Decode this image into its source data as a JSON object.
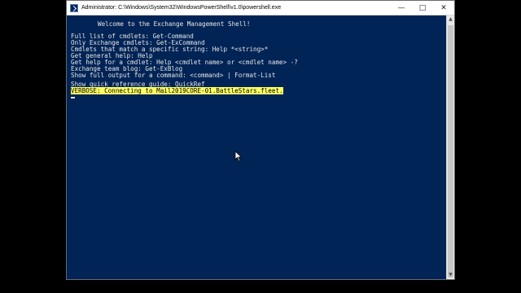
{
  "window": {
    "title": "Administrator: C:\\Windows\\System32\\WindowsPowerShell\\v1.0\\powershell.exe",
    "controls": [
      "—",
      "□",
      "✕"
    ]
  },
  "console": {
    "welcome": "Welcome to the Exchange Management Shell!",
    "lines": [
      "Full list of cmdlets: Get-Command",
      "Only Exchange cmdlets: Get-ExCommand",
      "Cmdlets that match a specific string: Help *<string>*",
      "Get general help: Help",
      "Get help for a cmdlet: Help <cmdlet name> or <cmdlet name> -?",
      "Exchange team blog: Get-ExBlog",
      "Show full output for a command: <command> | Format-List"
    ],
    "quickref": "Show quick reference guide: QuickRef",
    "verbose": "VERBOSE: Connecting to Mail2019CORE-01.BattleStars.fleet."
  },
  "colors": {
    "console_bg": "#012456",
    "text": "#e6e6e6",
    "verbose_bg": "#ffff66"
  },
  "icons": {
    "app": "powershell-icon",
    "pointer": "mouse-pointer-icon"
  }
}
